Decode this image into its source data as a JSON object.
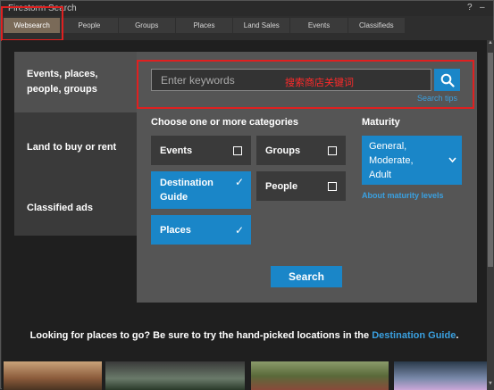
{
  "window": {
    "title": "Firestorm Search",
    "help_glyph": "?",
    "minimize_glyph": "–",
    "close_glyph": "×"
  },
  "tabs": [
    {
      "label": "Websearch",
      "active": true
    },
    {
      "label": "People"
    },
    {
      "label": "Groups"
    },
    {
      "label": "Places"
    },
    {
      "label": "Land Sales"
    },
    {
      "label": "Events"
    },
    {
      "label": "Classifieds"
    }
  ],
  "nav": {
    "items": [
      {
        "label1": "Events, places,",
        "label2": "people, groups"
      },
      {
        "label1": "Land to buy or rent"
      },
      {
        "label1": "Classified ads"
      }
    ]
  },
  "search": {
    "placeholder": "Enter keywords",
    "tips": "Search tips",
    "annotation": "搜索商店关键词",
    "button_icon": "search-icon"
  },
  "categories": {
    "heading": "Choose one or more categories",
    "items": [
      {
        "label1": "Events",
        "checked": false
      },
      {
        "label1": "Groups",
        "checked": false
      },
      {
        "label1": "Destination",
        "label2": "Guide",
        "checked": true
      },
      {
        "label1": "People",
        "checked": false
      },
      {
        "label1": "Places",
        "checked": true
      }
    ]
  },
  "maturity": {
    "heading": "Maturity",
    "line1": "General,",
    "line2": "Moderate,",
    "line3": "Adult",
    "about": "About maturity levels"
  },
  "search_button": "Search",
  "promo": {
    "text": "Looking for places to go? Be sure to try the hand-picked locations in the ",
    "link": "Destination Guide",
    "end": "."
  },
  "colors": {
    "accent": "#1a86c8",
    "link": "#3aa0e0",
    "annotation": "#e02020"
  }
}
